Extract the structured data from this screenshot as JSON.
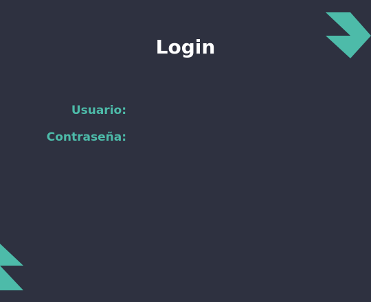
{
  "colors": {
    "background": "#2e3140",
    "accent": "#4dbba9",
    "title": "#ffffff"
  },
  "header": {
    "title": "Login"
  },
  "form": {
    "username": {
      "label": "Usuario:",
      "value": "",
      "placeholder": ""
    },
    "password": {
      "label": "Contraseña:",
      "value": "",
      "placeholder": ""
    }
  },
  "decorations": {
    "top_right_icon": "triangle-cluster-icon",
    "bottom_left_icon": "triangle-cluster-icon"
  }
}
